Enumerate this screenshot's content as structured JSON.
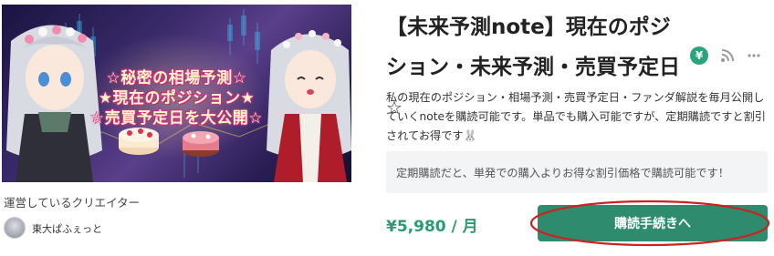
{
  "banner": {
    "line1": "☆秘密の相場予測☆",
    "line2": "★現在のポジション★",
    "line3": "☆売買予定日を大公開☆"
  },
  "magazine": {
    "title": "【未来予測note】現在のポジション・未来予測・売買予定日",
    "title_star": "☆",
    "description": "私の現在のポジション・相場予測・売買予定日・ファンダ解説を毎月公開していくnoteを購読可能です。単品でも購入可能ですが、定期購読ですと割引されてお得です🐰",
    "notice": "定期購読だと、単発での購入よりお得な割引価格で購読可能です！",
    "price": "¥5,980 / 月",
    "subscribe_label": "購読手続きへ"
  },
  "icons": {
    "coin": "yen-coin-icon",
    "coin_glyph": "¥",
    "rss": "rss-icon",
    "more": "more-icon"
  },
  "creator": {
    "heading": "運営しているクリエイター",
    "name": "東大ぱふぇっと"
  },
  "colors": {
    "accent": "#2e8b6e",
    "price": "#2a9a70",
    "annotation": "#cc2222"
  }
}
